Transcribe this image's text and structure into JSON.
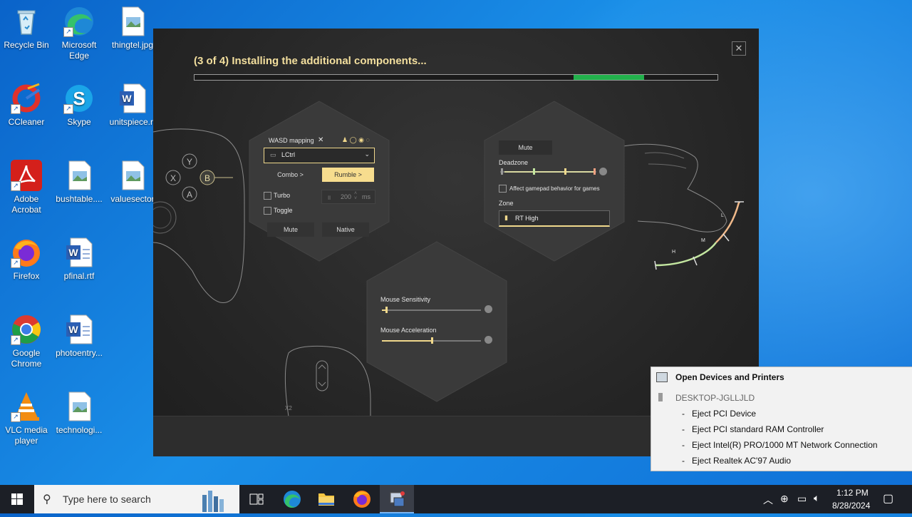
{
  "desktop": {
    "icons": [
      {
        "label": "Recycle Bin"
      },
      {
        "label": "Microsoft Edge"
      },
      {
        "label": "thingtel.jpg"
      },
      {
        "label": "CCleaner"
      },
      {
        "label": "Skype"
      },
      {
        "label": "unitspiece.rt"
      },
      {
        "label": "Adobe Acrobat"
      },
      {
        "label": "bushtable...."
      },
      {
        "label": "valuesector"
      },
      {
        "label": "Firefox"
      },
      {
        "label": "pfinal.rtf"
      },
      {
        "label": "Google Chrome"
      },
      {
        "label": "photoentry..."
      },
      {
        "label": "VLC media player"
      },
      {
        "label": "technologi..."
      }
    ]
  },
  "installer": {
    "status_text": "(3 of 4) Installing the additional components...",
    "progress_fraction": 0.86,
    "close_label": "✕",
    "controller_buttons": [
      "Y",
      "X",
      "B",
      "A"
    ],
    "mapping_panel": {
      "title": "WASD mapping",
      "key_value": "LCtrl",
      "combo_label": "Combo >",
      "rumble_label": "Rumble >",
      "turbo_label": "Turbo",
      "turbo_value": "200",
      "turbo_unit": "ms",
      "toggle_label": "Toggle",
      "mute_label": "Mute",
      "native_label": "Native"
    },
    "gamepad_panel": {
      "mute_label": "Mute",
      "deadzone_label": "Deadzone",
      "affect_label": "Affect gamepad behavior for games",
      "zone_label": "Zone",
      "zone_value": "RT High",
      "trigger_labels": [
        "L",
        "M",
        "H"
      ]
    },
    "mouse_panel": {
      "sensitivity_label": "Mouse Sensitivity",
      "sensitivity_value": 0.04,
      "acceleration_label": "Mouse Acceleration",
      "acceleration_value": 0.5,
      "mouse_button_label": "X2"
    }
  },
  "eject_menu": {
    "header": "Open Devices and Printers",
    "computer": "DESKTOP-JGLLJLD",
    "items": [
      "Eject PCI Device",
      "Eject PCI standard RAM Controller",
      "Eject Intel(R) PRO/1000 MT Network Connection",
      "Eject Realtek AC'97 Audio"
    ]
  },
  "taskbar": {
    "search_placeholder": "Type here to search",
    "time": "1:12 PM",
    "date": "8/28/2024"
  },
  "colors": {
    "accent_gold": "#f7dd8e",
    "progress_green": "#22b14c",
    "desktop_blue": "#0f6fd6"
  }
}
